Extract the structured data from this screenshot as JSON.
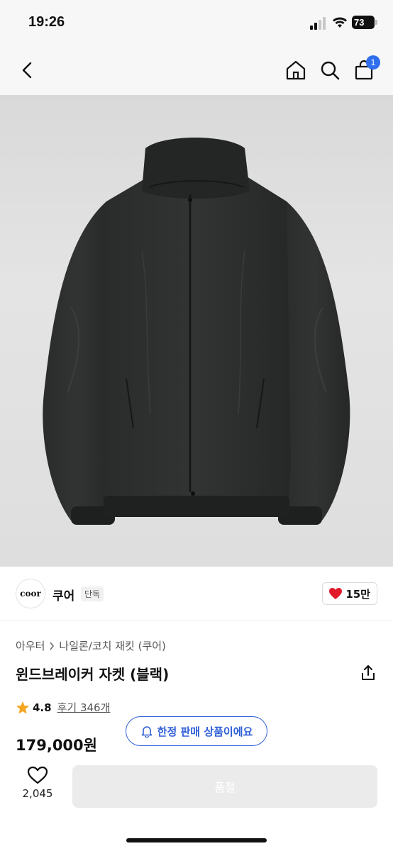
{
  "status_bar": {
    "time": "19:26",
    "battery": "73"
  },
  "nav": {
    "cart_count": "1",
    "icons": [
      "back-arrow-icon",
      "home-icon",
      "search-icon",
      "shopping-bag-icon"
    ]
  },
  "product_image": {
    "description_icon": "black-windbreaker-jacket-photo"
  },
  "brand": {
    "logo_text": "coor",
    "name": "쿠어",
    "tag": "단독",
    "likes": "15만"
  },
  "breadcrumb": {
    "category": "아우터",
    "subcategory": "나일론/코치 재킷 (쿠어)"
  },
  "product": {
    "title": "윈드브레이커 자켓 (블랙)",
    "rating": "4.8",
    "reviews": "후기 346개",
    "price": "179,000원",
    "limited_badge": "한정 판매 상품이에요"
  },
  "bottom_bar": {
    "wish_count": "2,045",
    "buy_label": "품절"
  },
  "colors": {
    "accent": "#2f5fd8",
    "badge": "#2f6fed",
    "heart": "#e0192b",
    "star": "#f5a623"
  }
}
